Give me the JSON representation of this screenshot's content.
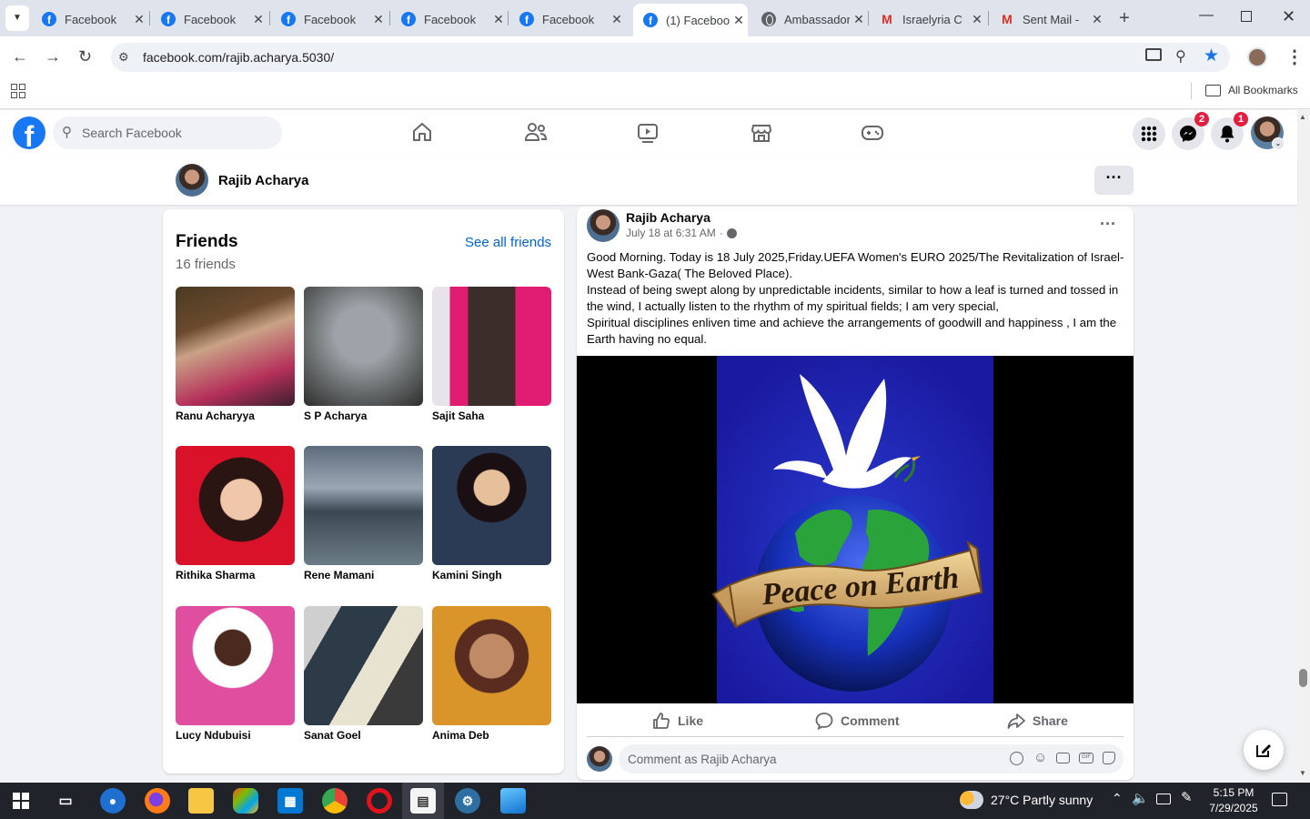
{
  "tabs": [
    {
      "label": "Facebook",
      "icon": "facebook-icon"
    },
    {
      "label": "Facebook",
      "icon": "facebook-icon"
    },
    {
      "label": "Facebook",
      "icon": "facebook-icon"
    },
    {
      "label": "Facebook",
      "icon": "facebook-icon"
    },
    {
      "label": "Facebook",
      "icon": "facebook-icon"
    },
    {
      "label": "(1) Facebook",
      "icon": "facebook-icon",
      "active": true
    },
    {
      "label": "Ambassador",
      "icon": "globe-icon"
    },
    {
      "label": "Israelyria C",
      "icon": "gmail-icon"
    },
    {
      "label": "Sent Mail -",
      "icon": "gmail-icon"
    }
  ],
  "browser": {
    "url": "facebook.com/rajib.acharya.5030/",
    "bookmarks_label": "All Bookmarks"
  },
  "facebook": {
    "search_placeholder": "Search Facebook",
    "messenger_badge": "2",
    "notifications_badge": "1"
  },
  "profile": {
    "name": "Rajib Acharya"
  },
  "friends": {
    "title": "Friends",
    "see_all": "See all friends",
    "count_label": "16 friends",
    "items": [
      {
        "name": "Ranu Acharyya"
      },
      {
        "name": "S P Acharya"
      },
      {
        "name": "Sajit Saha"
      },
      {
        "name": "Rithika Sharma"
      },
      {
        "name": "Rene Mamani"
      },
      {
        "name": "Kamini Singh"
      },
      {
        "name": "Lucy Ndubuisi"
      },
      {
        "name": "Sanat Goel"
      },
      {
        "name": "Anima Deb"
      }
    ]
  },
  "post": {
    "author": "Rajib Acharya",
    "time": "July 18 at 6:31 AM",
    "visibility_sep": "·",
    "lines": [
      "Good Morning. Today is 18 July 2025,Friday.UEFA Women's EURO 2025/The Revitalization of Israel-West Bank-Gaza( The Beloved Place).",
      "Instead of being swept along by unpredictable incidents, similar to how a leaf is turned and tossed in the wind, I actually listen to the rhythm of my spiritual fields;  I am very special,",
      "Spiritual disciplines enliven time and achieve the arrangements of goodwill and happiness , I am the Earth having no equal."
    ],
    "image_banner": "Peace on Earth",
    "like_label": "Like",
    "comment_label": "Comment",
    "share_label": "Share",
    "comment_placeholder": "Comment as Rajib Acharya"
  },
  "taskbar": {
    "weather": "27°C  Partly sunny",
    "time": "5:15 PM",
    "date": "7/29/2025"
  }
}
